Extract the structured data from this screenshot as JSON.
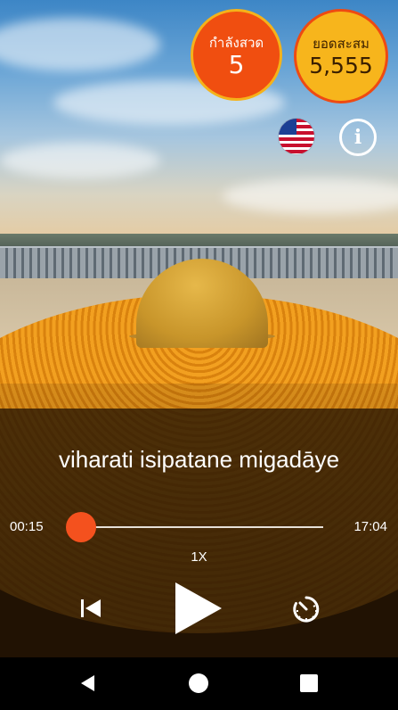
{
  "badges": {
    "chanting": {
      "label": "กำลังสวด",
      "value": "5"
    },
    "total": {
      "label": "ยอดสะสม",
      "value": "5,555"
    }
  },
  "icons": {
    "language": "us-flag-icon",
    "info": "info-icon",
    "prev": "skip-previous-icon",
    "play": "play-icon",
    "timer": "timer-icon"
  },
  "player": {
    "verse": "viharati isipatane migadāye",
    "current_time": "00:15",
    "total_time": "17:04",
    "speed": "1X",
    "progress": 0.015
  },
  "colors": {
    "accent": "#f4511e",
    "badge_orange": "#f04e10",
    "badge_yellow": "#f7b51c"
  }
}
